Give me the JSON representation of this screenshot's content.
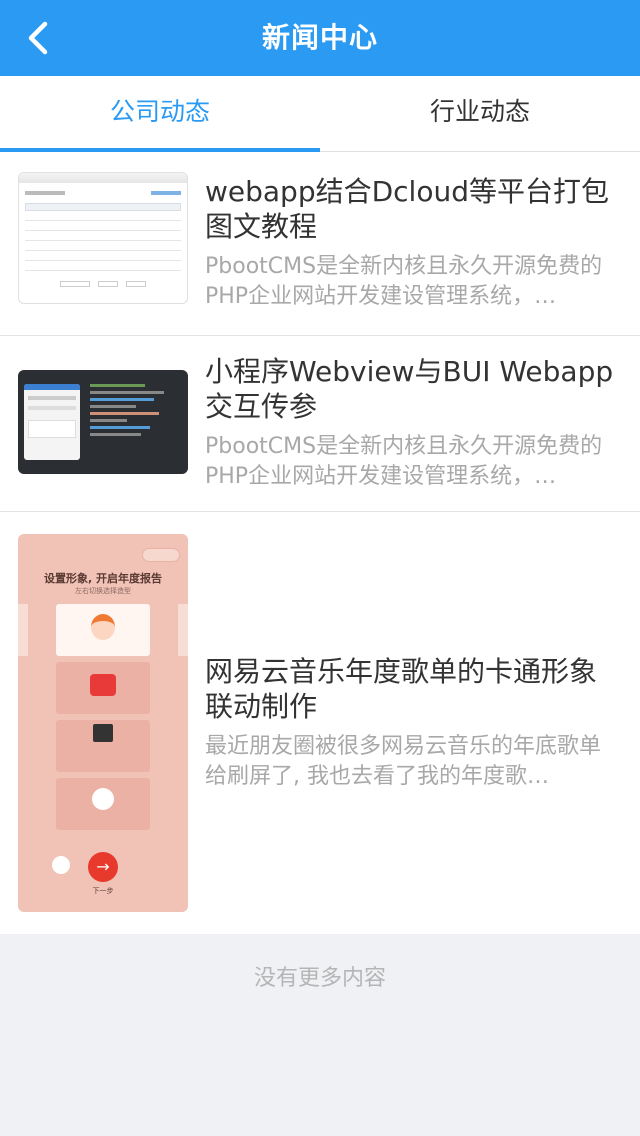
{
  "header": {
    "title": "新闻中心",
    "back_icon": "chevron-left-icon"
  },
  "tabs": [
    {
      "label": "公司动态",
      "active": true
    },
    {
      "label": "行业动态",
      "active": false
    }
  ],
  "articles": [
    {
      "title": "webapp结合Dcloud等平台打包图文教程",
      "description": "PbootCMS是全新内核且永久开源免费的PHP企业网站开发建设管理系统，…",
      "thumbnail": "table-screenshot"
    },
    {
      "title": "小程序Webview与BUI Webapp交互传参",
      "description": "PbootCMS是全新内核且永久开源免费的PHP企业网站开发建设管理系统，…",
      "thumbnail": "code-editor-screenshot"
    },
    {
      "title": "网易云音乐年度歌单的卡通形象联动制作",
      "description": "最近朋友圈被很多网易云音乐的年底歌单给刷屏了, 我也去看了我的年度歌…",
      "thumbnail": "cartoon-avatar-builder",
      "thumb_text": {
        "heading": "设置形象, 开启年度报告",
        "subheading": "左右切换选择造型",
        "next_label": "下一步"
      }
    }
  ],
  "footer": {
    "no_more": "没有更多内容"
  },
  "colors": {
    "primary": "#2a9af3",
    "background": "#eff1f5"
  }
}
